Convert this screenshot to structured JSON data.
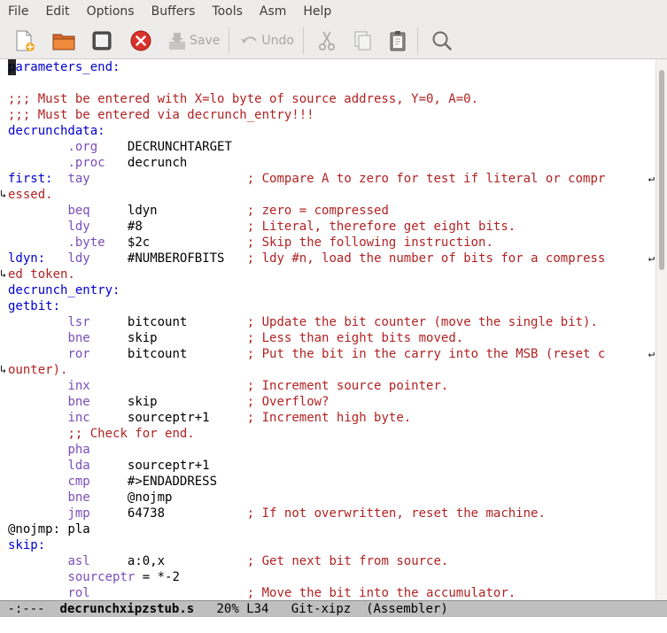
{
  "menubar": {
    "items": [
      "File",
      "Edit",
      "Options",
      "Buffers",
      "Tools",
      "Asm",
      "Help"
    ]
  },
  "toolbar": {
    "save_label": "Save",
    "undo_label": "Undo",
    "buttons": [
      {
        "name": "new-file-icon"
      },
      {
        "name": "open-folder-icon"
      },
      {
        "name": "dired-icon"
      },
      {
        "name": "close-icon"
      },
      {
        "name": "save-icon"
      },
      {
        "name": "undo-icon"
      },
      {
        "name": "cut-icon"
      },
      {
        "name": "copy-icon"
      },
      {
        "name": "paste-icon"
      },
      {
        "name": "search-icon"
      }
    ]
  },
  "editor": {
    "lines": [
      [
        [
          "lbl",
          "parameters_end:"
        ]
      ],
      [],
      [
        [
          "cmt",
          ";;; Must be entered with X=lo byte of source address, Y=0, A=0."
        ]
      ],
      [
        [
          "cmt",
          ";;; Must be entered via decrunch_entry!!!"
        ]
      ],
      [
        [
          "lbl",
          "decrunchdata:"
        ]
      ],
      [
        [
          "plain",
          "        "
        ],
        [
          "dir",
          ".org"
        ],
        [
          "plain",
          "    "
        ],
        [
          "arg",
          "DECRUNCHTARGET"
        ]
      ],
      [
        [
          "plain",
          "        "
        ],
        [
          "dir",
          ".proc"
        ],
        [
          "plain",
          "   "
        ],
        [
          "arg",
          "decrunch"
        ]
      ],
      [
        [
          "lbl",
          "first:"
        ],
        [
          "plain",
          "  "
        ],
        [
          "ins",
          "tay"
        ],
        [
          "plain",
          "                     "
        ],
        [
          "cmt",
          "; Compare A to zero for test if literal or compr"
        ]
      ],
      [
        [
          "cmt",
          "essed."
        ]
      ],
      [
        [
          "plain",
          "        "
        ],
        [
          "ins",
          "beq"
        ],
        [
          "plain",
          "     "
        ],
        [
          "arg",
          "ldyn"
        ],
        [
          "plain",
          "            "
        ],
        [
          "cmt",
          "; zero = compressed"
        ]
      ],
      [
        [
          "plain",
          "        "
        ],
        [
          "ins",
          "ldy"
        ],
        [
          "plain",
          "     "
        ],
        [
          "arg",
          "#8"
        ],
        [
          "plain",
          "              "
        ],
        [
          "cmt",
          "; Literal, therefore get eight bits."
        ]
      ],
      [
        [
          "plain",
          "        "
        ],
        [
          "dir",
          ".byte"
        ],
        [
          "plain",
          "   "
        ],
        [
          "arg",
          "$2c"
        ],
        [
          "plain",
          "             "
        ],
        [
          "cmt",
          "; Skip the following instruction."
        ]
      ],
      [
        [
          "lbl",
          "ldyn:"
        ],
        [
          "plain",
          "   "
        ],
        [
          "ins",
          "ldy"
        ],
        [
          "plain",
          "     "
        ],
        [
          "arg",
          "#NUMBEROFBITS"
        ],
        [
          "plain",
          "   "
        ],
        [
          "cmt",
          "; ldy #n, load the number of bits for a compress"
        ]
      ],
      [
        [
          "cmt",
          "ed token."
        ]
      ],
      [
        [
          "lbl",
          "decrunch_entry:"
        ]
      ],
      [
        [
          "lbl",
          "getbit:"
        ]
      ],
      [
        [
          "plain",
          "        "
        ],
        [
          "ins",
          "lsr"
        ],
        [
          "plain",
          "     "
        ],
        [
          "arg",
          "bitcount"
        ],
        [
          "plain",
          "        "
        ],
        [
          "cmt",
          "; Update the bit counter (move the single bit)."
        ]
      ],
      [
        [
          "plain",
          "        "
        ],
        [
          "ins",
          "bne"
        ],
        [
          "plain",
          "     "
        ],
        [
          "arg",
          "skip"
        ],
        [
          "plain",
          "            "
        ],
        [
          "cmt",
          "; Less than eight bits moved."
        ]
      ],
      [
        [
          "plain",
          "        "
        ],
        [
          "ins",
          "ror"
        ],
        [
          "plain",
          "     "
        ],
        [
          "arg",
          "bitcount"
        ],
        [
          "plain",
          "        "
        ],
        [
          "cmt",
          "; Put the bit in the carry into the MSB (reset c"
        ]
      ],
      [
        [
          "cmt",
          "ounter)."
        ]
      ],
      [
        [
          "plain",
          "        "
        ],
        [
          "ins",
          "inx"
        ],
        [
          "plain",
          "                     "
        ],
        [
          "cmt",
          "; Increment source pointer."
        ]
      ],
      [
        [
          "plain",
          "        "
        ],
        [
          "ins",
          "bne"
        ],
        [
          "plain",
          "     "
        ],
        [
          "arg",
          "skip"
        ],
        [
          "plain",
          "            "
        ],
        [
          "cmt",
          "; Overflow?"
        ]
      ],
      [
        [
          "plain",
          "        "
        ],
        [
          "ins",
          "inc"
        ],
        [
          "plain",
          "     "
        ],
        [
          "arg",
          "sourceptr+1"
        ],
        [
          "plain",
          "     "
        ],
        [
          "cmt",
          "; Increment high byte."
        ]
      ],
      [
        [
          "plain",
          "        "
        ],
        [
          "cmt",
          ";; Check for end."
        ]
      ],
      [
        [
          "plain",
          "        "
        ],
        [
          "ins",
          "pha"
        ]
      ],
      [
        [
          "plain",
          "        "
        ],
        [
          "ins",
          "lda"
        ],
        [
          "plain",
          "     "
        ],
        [
          "arg",
          "sourceptr+1"
        ]
      ],
      [
        [
          "plain",
          "        "
        ],
        [
          "ins",
          "cmp"
        ],
        [
          "plain",
          "     "
        ],
        [
          "arg",
          "#>ENDADDRESS"
        ]
      ],
      [
        [
          "plain",
          "        "
        ],
        [
          "ins",
          "bne"
        ],
        [
          "plain",
          "     "
        ],
        [
          "arg",
          "@nojmp"
        ]
      ],
      [
        [
          "plain",
          "        "
        ],
        [
          "ins",
          "jmp"
        ],
        [
          "plain",
          "     "
        ],
        [
          "arg",
          "64738"
        ],
        [
          "plain",
          "           "
        ],
        [
          "cmt",
          "; If not overwritten, reset the machine."
        ]
      ],
      [
        [
          "arg",
          "@nojmp: pla"
        ]
      ],
      [
        [
          "lbl",
          "skip:"
        ]
      ],
      [
        [
          "plain",
          "        "
        ],
        [
          "ins",
          "asl"
        ],
        [
          "plain",
          "     "
        ],
        [
          "arg",
          "a:0,x"
        ],
        [
          "plain",
          "           "
        ],
        [
          "cmt",
          "; Get next bit from source."
        ]
      ],
      [
        [
          "plain",
          "        "
        ],
        [
          "ins",
          "sourceptr"
        ],
        [
          "plain",
          " = *-2"
        ]
      ],
      [
        [
          "plain",
          "        "
        ],
        [
          "ins",
          "rol"
        ],
        [
          "plain",
          "                     "
        ],
        [
          "cmt",
          "; Move the bit into the accumulator."
        ]
      ]
    ],
    "wrap_right_rows": [
      7,
      12,
      18
    ],
    "wrap_left_rows": [
      8,
      13,
      19
    ],
    "scroll_position": 0.2,
    "scroll_visible_fraction": 0.37
  },
  "modeline": {
    "status": "-:---",
    "buffer": "decrunchxipzstub.s",
    "position": "20% L34",
    "vc": "Git-xipz",
    "mode": "(Assembler)"
  }
}
